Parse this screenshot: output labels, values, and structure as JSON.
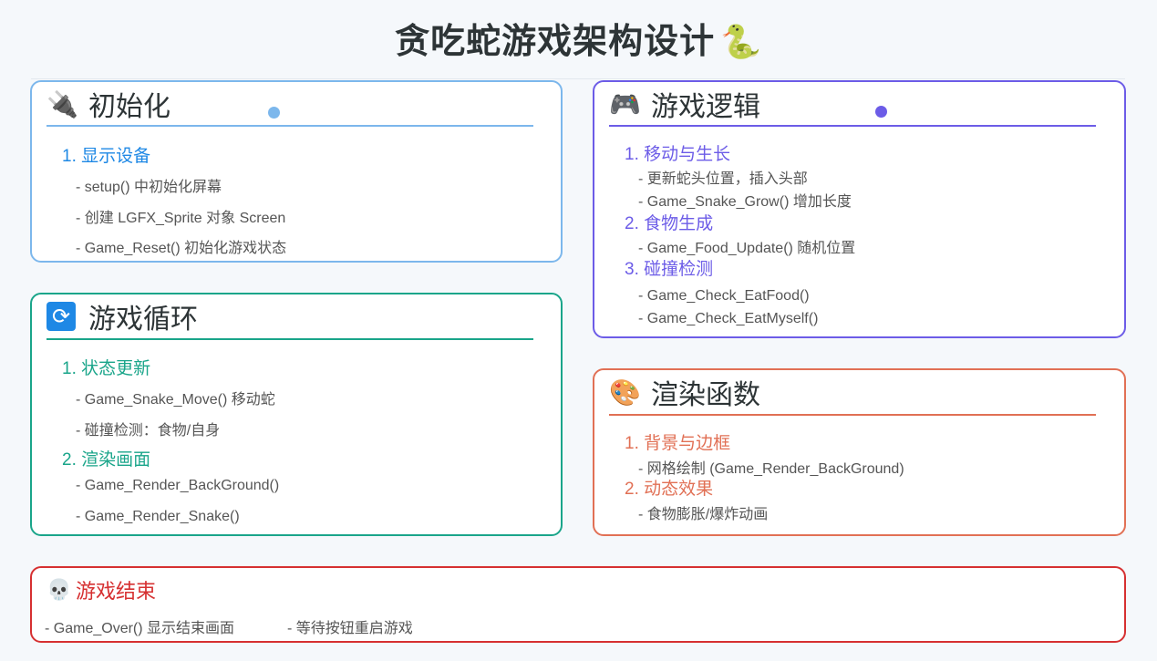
{
  "title": "贪吃蛇游戏架构设计",
  "title_icon": "🐍",
  "colors": {
    "init": "#7cb7ec",
    "loop": "#1aa58a",
    "logic": "#6c5ce7",
    "render": "#e17055",
    "end": "#d63031"
  },
  "init": {
    "icon": "plug-icon",
    "icon_glyph": "🔌",
    "title": "初始化",
    "sections": [
      {
        "label": "1. 显示设备",
        "items": [
          "- setup() 中初始化屏幕",
          "- 创建 LGFX_Sprite 对象 Screen",
          "- Game_Reset() 初始化游戏状态"
        ]
      }
    ]
  },
  "loop": {
    "icon": "refresh-icon",
    "icon_glyph": "🔄",
    "title": "游戏循环",
    "sections": [
      {
        "label": "1. 状态更新",
        "items": [
          "- Game_Snake_Move() 移动蛇",
          "- 碰撞检测：食物/自身"
        ]
      },
      {
        "label": "2. 渲染画面",
        "items": [
          "- Game_Render_BackGround()",
          "- Game_Render_Snake()"
        ]
      }
    ]
  },
  "logic": {
    "icon": "gamepad-icon",
    "icon_glyph": "🎮",
    "title": "游戏逻辑",
    "sections": [
      {
        "label": "1. 移动与生长",
        "items": [
          "- 更新蛇头位置，插入头部",
          "- Game_Snake_Grow() 增加长度"
        ]
      },
      {
        "label": "2. 食物生成",
        "items": [
          "- Game_Food_Update() 随机位置"
        ]
      },
      {
        "label": "3. 碰撞检测",
        "items": [
          "- Game_Check_EatFood()",
          "- Game_Check_EatMyself()"
        ]
      }
    ]
  },
  "render": {
    "icon": "palette-icon",
    "icon_glyph": "🎨",
    "title": "渲染函数",
    "sections": [
      {
        "label": "1. 背景与边框",
        "items": [
          "- 网格绘制 (Game_Render_BackGround)"
        ]
      },
      {
        "label": "2. 动态效果",
        "items": [
          "- 食物膨胀/爆炸动画"
        ]
      }
    ]
  },
  "end": {
    "icon": "skull-icon",
    "icon_glyph": "💀",
    "title": "游戏结束",
    "items": [
      "- Game_Over() 显示结束画面",
      "- 等待按钮重启游戏"
    ]
  }
}
